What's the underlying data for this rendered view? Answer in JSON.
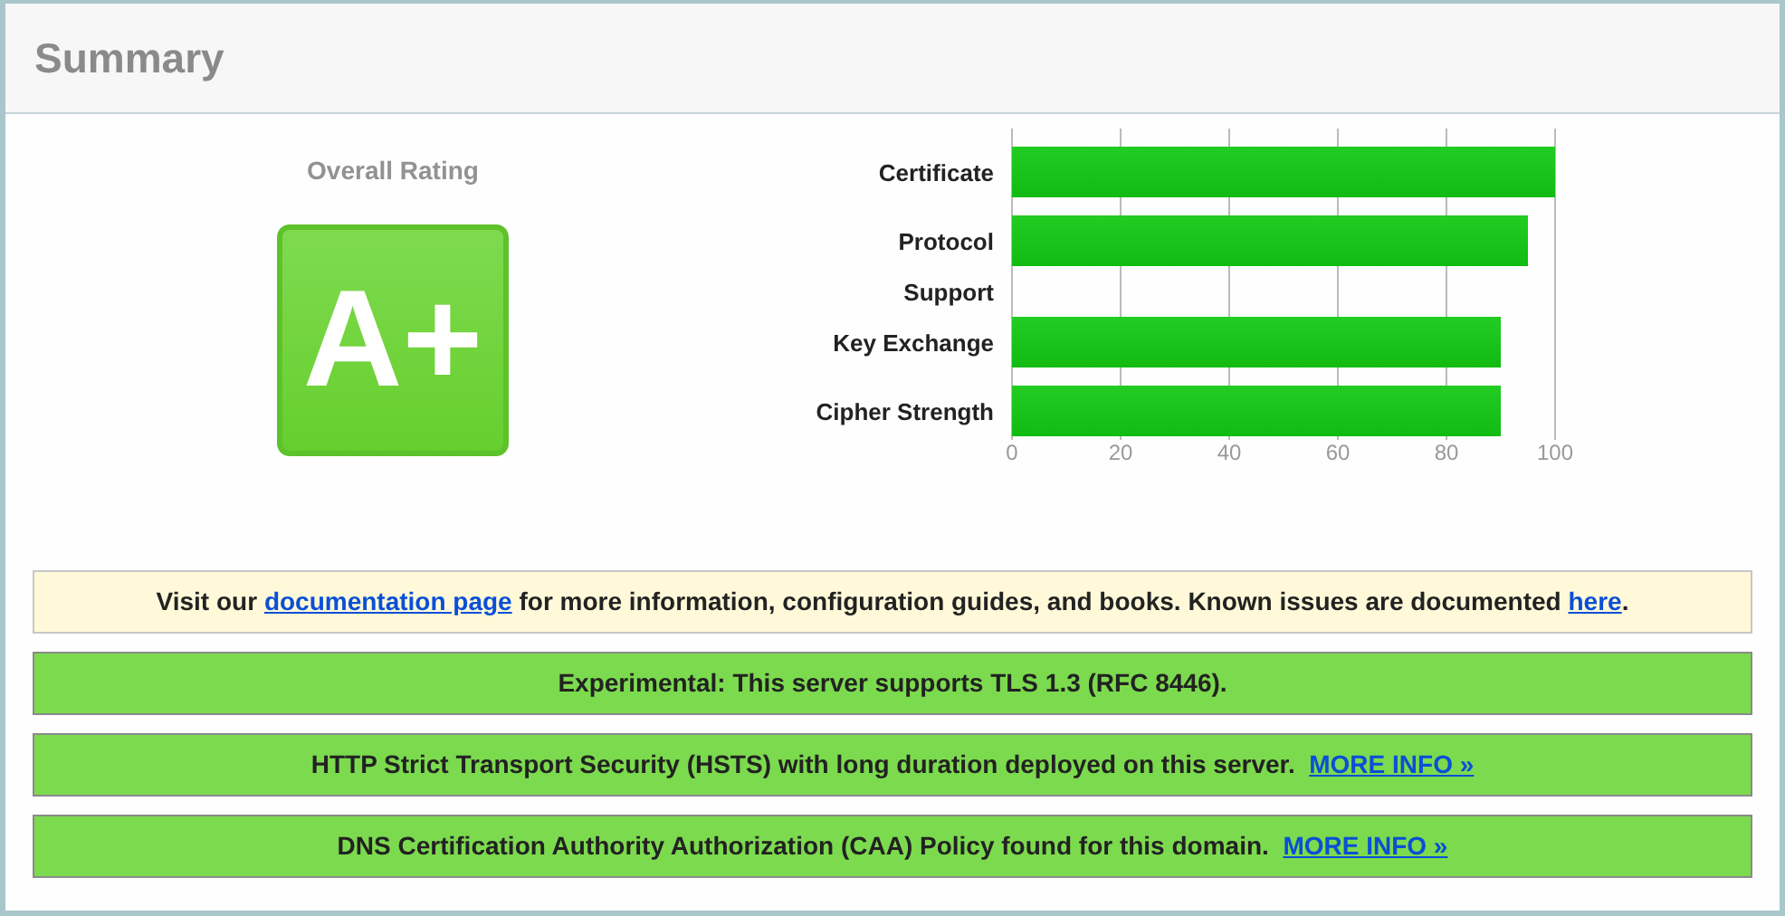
{
  "header": {
    "title": "Summary"
  },
  "rating": {
    "label": "Overall Rating",
    "grade": "A+"
  },
  "chart": {
    "chart_data": {
      "type": "bar",
      "orientation": "horizontal",
      "categories": [
        "Certificate",
        "Protocol Support",
        "Key Exchange",
        "Cipher Strength"
      ],
      "series": [
        {
          "color": "#11bb11",
          "values": [
            100,
            95,
            90,
            90
          ]
        }
      ],
      "xlim": [
        0,
        100
      ],
      "xticks": [
        0,
        20,
        40,
        60,
        80,
        100
      ],
      "grid": true
    }
  },
  "notices": [
    {
      "kind": "info",
      "parts": [
        {
          "kind": "text",
          "text": "Visit our "
        },
        {
          "kind": "link",
          "text": "documentation page"
        },
        {
          "kind": "text",
          "text": " for more information, configuration guides, and books. Known issues are documented "
        },
        {
          "kind": "link",
          "text": "here"
        },
        {
          "kind": "text",
          "text": "."
        }
      ]
    },
    {
      "kind": "success",
      "parts": [
        {
          "kind": "text",
          "text": "Experimental: This server supports TLS 1.3 (RFC 8446)."
        }
      ]
    },
    {
      "kind": "success",
      "parts": [
        {
          "kind": "text",
          "text": "HTTP Strict Transport Security (HSTS) with long duration deployed on this server.  "
        },
        {
          "kind": "link",
          "text": "MORE INFO »"
        }
      ]
    },
    {
      "kind": "success",
      "parts": [
        {
          "kind": "text",
          "text": "DNS Certification Authority Authorization (CAA) Policy found for this domain.  "
        },
        {
          "kind": "link",
          "text": "MORE INFO »"
        }
      ]
    }
  ]
}
